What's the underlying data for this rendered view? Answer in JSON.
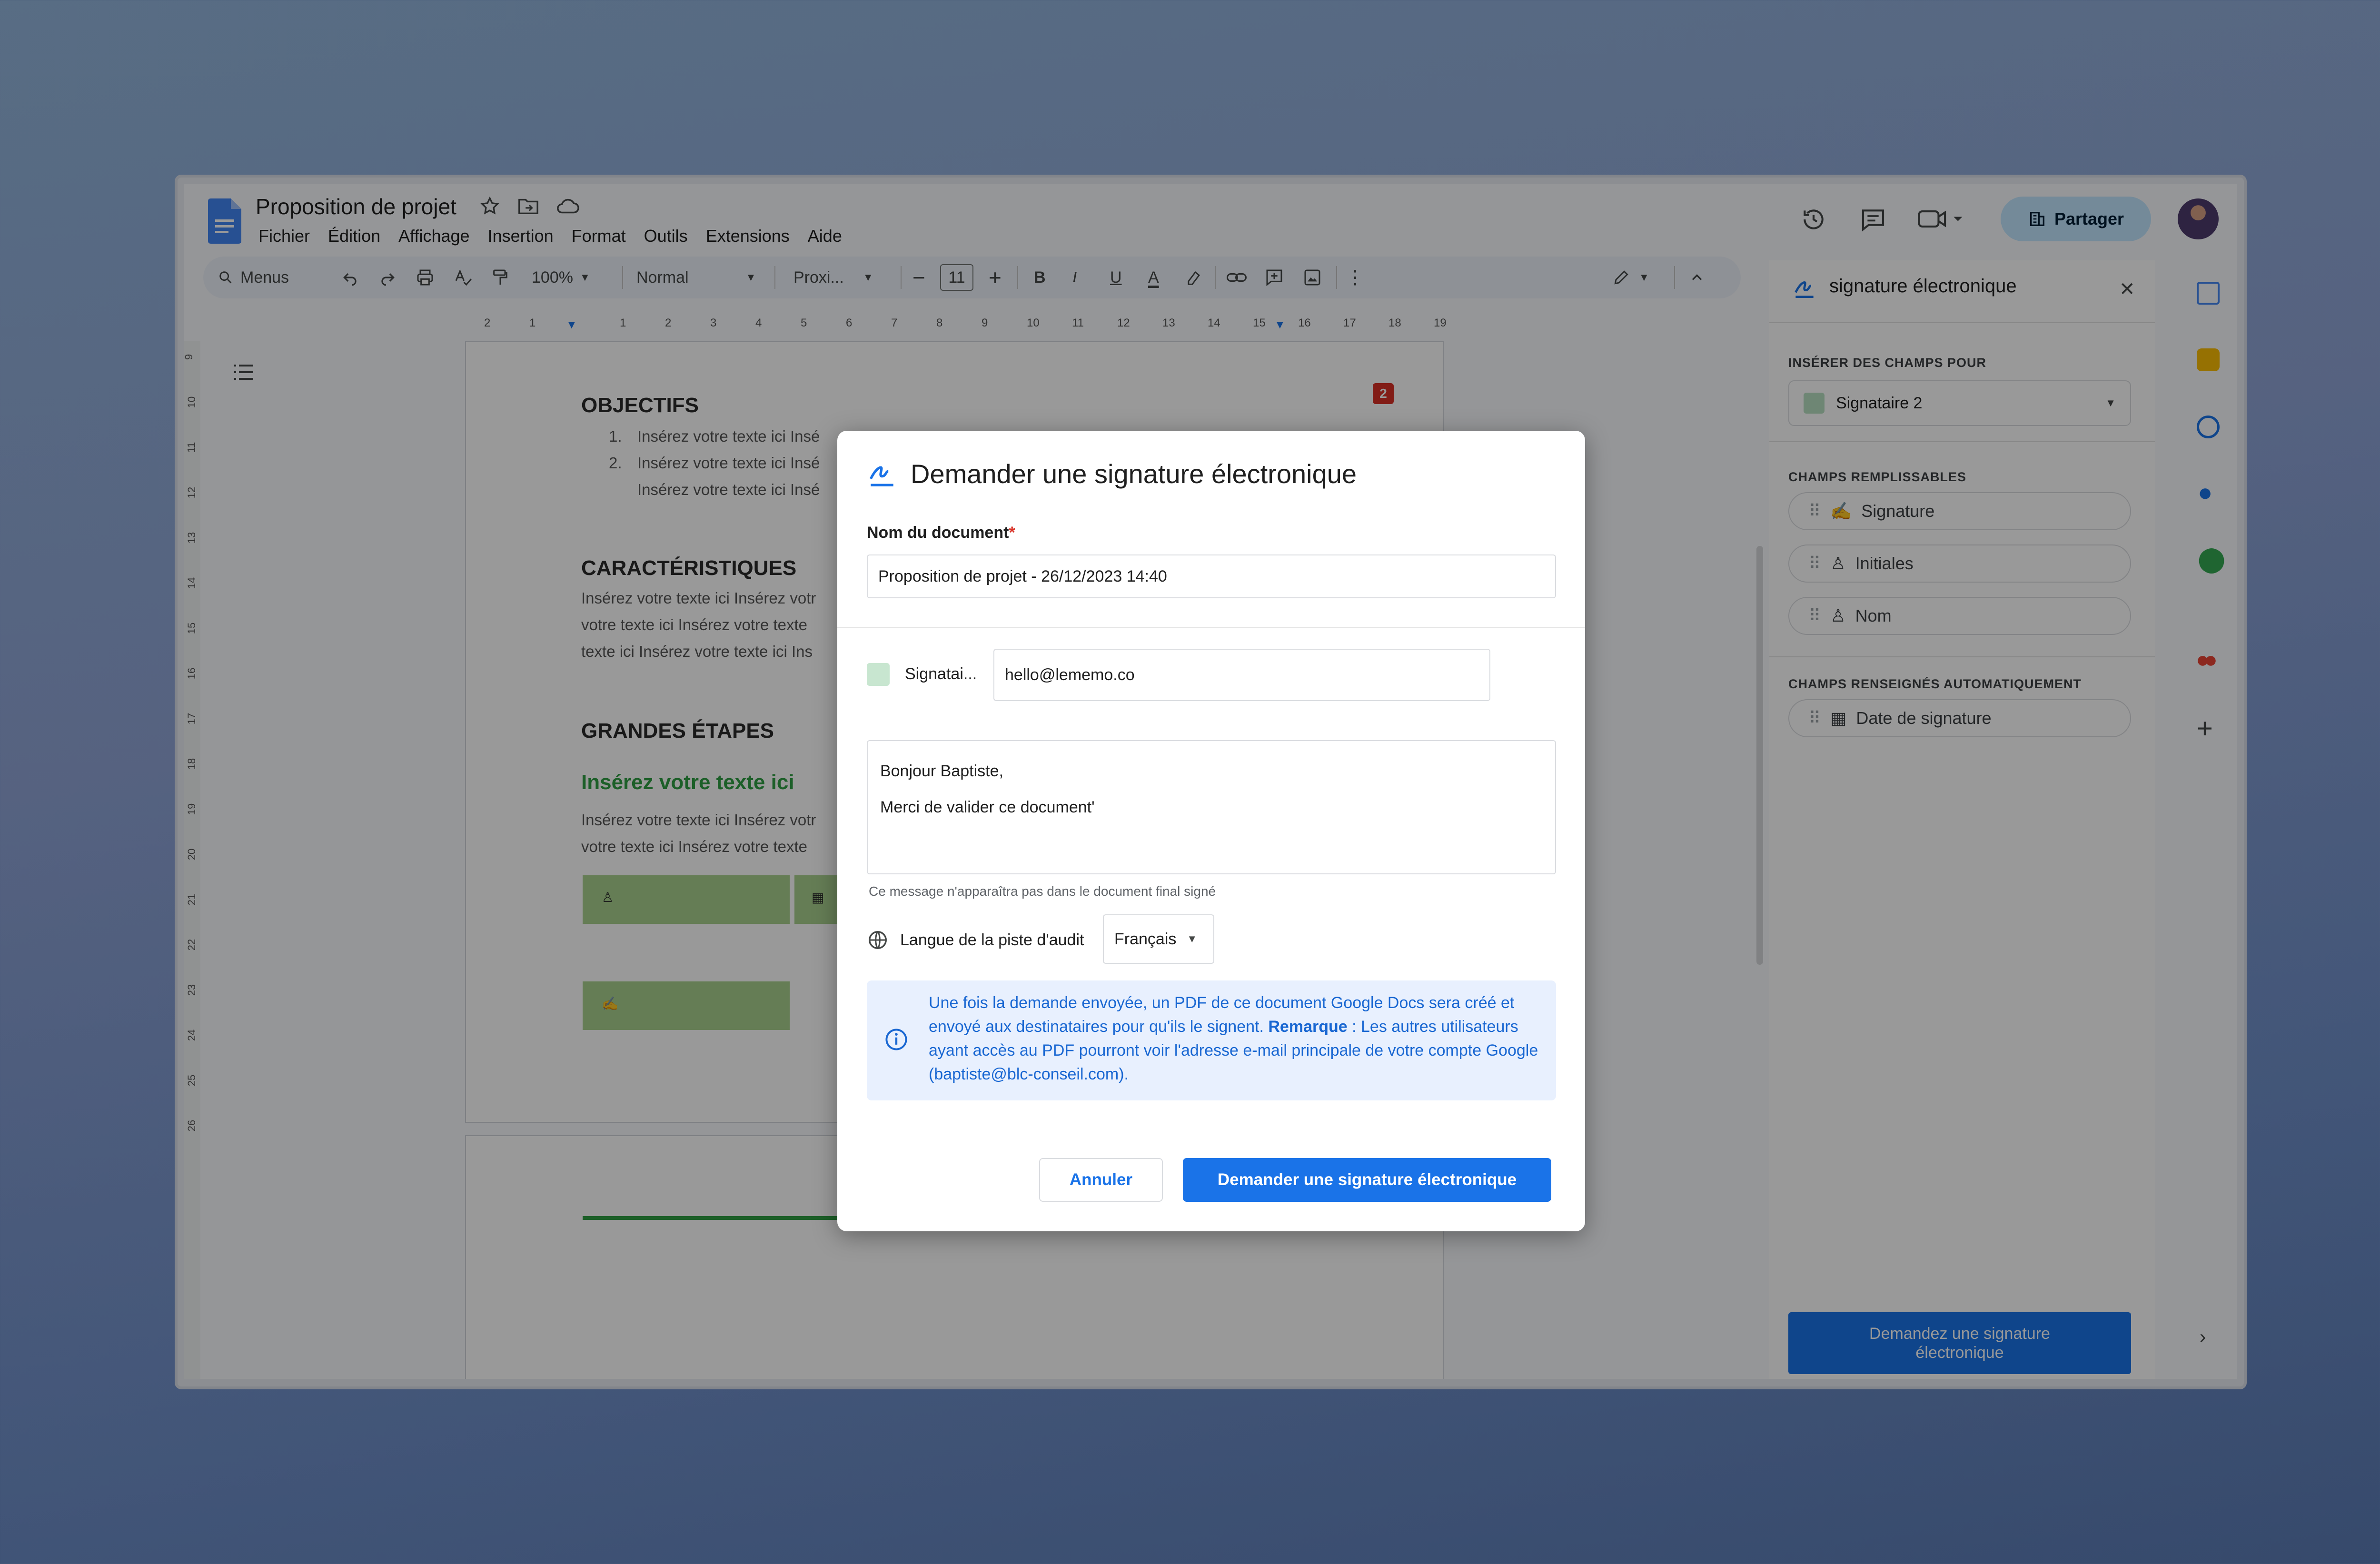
{
  "doc": {
    "title": "Proposition de projet",
    "menu": [
      "Fichier",
      "Édition",
      "Affichage",
      "Insertion",
      "Format",
      "Outils",
      "Extensions",
      "Aide"
    ],
    "share_label": "Partager"
  },
  "toolbar": {
    "search_label": "Menus",
    "zoom": "100%",
    "style": "Normal",
    "font": "Proxi...",
    "font_size": "11",
    "bold": "B",
    "italic": "I",
    "underline": "U",
    "text_color": "A"
  },
  "ruler": {
    "marks": [
      "2",
      "1",
      "",
      "1",
      "2",
      "3",
      "4",
      "5",
      "6",
      "7",
      "8",
      "9",
      "10",
      "11",
      "12",
      "13",
      "14",
      "15",
      "16",
      "17",
      "18",
      "19"
    ],
    "vmarks": [
      "9",
      "10",
      "11",
      "12",
      "13",
      "14",
      "15",
      "16",
      "17",
      "18",
      "19",
      "20",
      "21",
      "22",
      "23",
      "24",
      "25",
      "26"
    ]
  },
  "page": {
    "comment_count": "2",
    "objectifs_title": "OBJECTIFS",
    "objectifs_items": [
      "Insérez votre texte ici Insé",
      "Insérez votre texte ici Insé",
      "Insérez votre texte ici Insé"
    ],
    "caract_title": "CARACTÉRISTIQUES",
    "caract_lines": [
      "Insérez votre texte ici Insérez votr",
      "votre texte ici Insérez votre texte",
      "texte ici Insérez votre texte ici Ins"
    ],
    "etapes_title": "GRANDES ÉTAPES",
    "green_heading": "Insérez votre texte ici",
    "etapes_lines": [
      "Insérez votre texte ici Insérez votr",
      "votre texte ici Insérez votre texte"
    ]
  },
  "panel": {
    "title": "signature électronique",
    "insert_section": "INSÉRER DES CHAMPS POUR",
    "signer_select": "Signataire 2",
    "fillable_section": "CHAMPS REMPLISSABLES",
    "fillable": [
      "Signature",
      "Initiales",
      "Nom"
    ],
    "auto_section": "CHAMPS RENSEIGNÉS AUTOMATIQUEMENT",
    "auto": [
      "Date de signature"
    ],
    "button_line1": "Demandez une signature",
    "button_line2": "électronique"
  },
  "dialog": {
    "title": "Demander une signature électronique",
    "doc_name_label": "Nom du document",
    "required_mark": "*",
    "doc_name_value": "Proposition de projet - 26/12/2023 14:40",
    "signer_label": "Signatai...",
    "signer_email": "hello@lememo.co",
    "message_line1": "Bonjour Baptiste,",
    "message_line2": "Merci de valider ce document'",
    "message_hint": "Ce message n'apparaîtra pas dans le document final signé",
    "audit_label": "Langue de la piste d'audit",
    "audit_value": "Français",
    "info_part1": "Une fois la demande envoyée, un PDF de ce document Google Docs sera créé et envoyé aux destinataires pour qu'ils le signent. ",
    "info_bold": "Remarque",
    "info_part2": " : Les autres utilisateurs ayant accès au PDF pourront voir l'adresse e-mail principale de votre compte Google (baptiste@blc-conseil.com).",
    "cancel": "Annuler",
    "submit": "Demander une signature électronique"
  },
  "colors": {
    "accent": "#1a73e8",
    "share_bg": "#c2e7ff",
    "signer_swatch": "#b7dfc2",
    "info_bg": "#e8f0fe",
    "green_text": "#2f9e44",
    "comment_badge": "#d93025"
  },
  "icons": [
    "docs-icon",
    "star-icon",
    "folder-move-icon",
    "cloud-icon",
    "history-icon",
    "comment-icon",
    "video-icon",
    "building-icon",
    "search-icon",
    "undo-icon",
    "redo-icon",
    "print-icon",
    "spellcheck-icon",
    "paint-format-icon",
    "link-icon",
    "add-comment-icon",
    "image-icon",
    "more-icon",
    "pencil-icon",
    "chevron-up-icon",
    "list-outline-icon",
    "signature-icon",
    "close-icon",
    "drag-handle-icon",
    "person-icon",
    "calendar-icon",
    "globe-icon",
    "info-icon",
    "plus-icon",
    "chevron-right-icon"
  ]
}
